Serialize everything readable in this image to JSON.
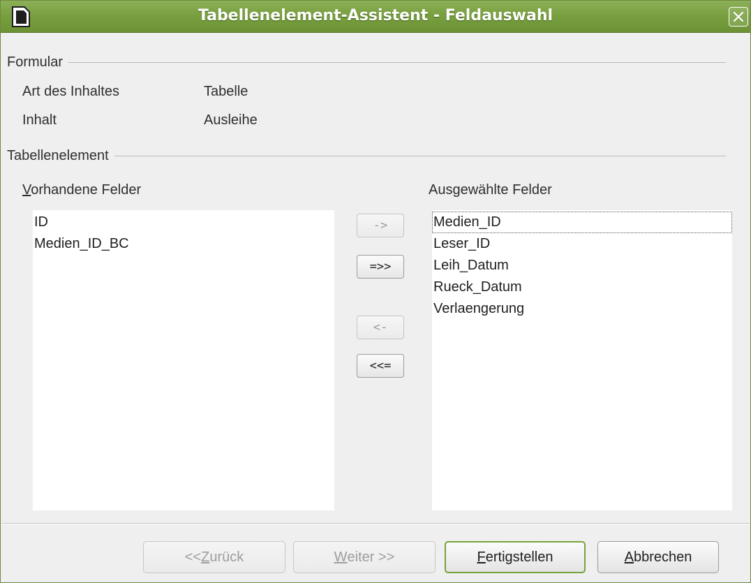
{
  "window": {
    "title": "Tabellenelement-Assistent - Feldauswahl"
  },
  "formular": {
    "heading": "Formular",
    "content_type_label": "Art des Inhaltes",
    "content_type_value": "Tabelle",
    "content_label": "Inhalt",
    "content_value": "Ausleihe"
  },
  "tabellenelement": {
    "heading": "Tabellenelement",
    "available_label_mnemonic": "V",
    "available_label_rest": "orhandene Felder",
    "available_fields": [
      "ID",
      "Medien_ID_BC"
    ],
    "selected_label_pre": "Aus",
    "selected_label_mnemonic": "g",
    "selected_label_rest": "ewählte Felder",
    "selected_fields": [
      "Medien_ID",
      "Leser_ID",
      "Leih_Datum",
      "Rueck_Datum",
      "Verlaengerung"
    ],
    "move_right": "->",
    "move_all_right": "=>>",
    "move_left": "<-",
    "move_all_left": "<<="
  },
  "footer": {
    "back_pre": "<< ",
    "back_mnemonic": "Z",
    "back_rest": "urück",
    "next_mnemonic": "W",
    "next_rest": "eiter >>",
    "finish_mnemonic": "F",
    "finish_rest": "ertigstellen",
    "cancel_mnemonic": "A",
    "cancel_rest": "bbrechen"
  },
  "colors": {
    "titlebar": "#79a040",
    "dialog_bg": "#efefef",
    "default_button_border": "#77a33a"
  }
}
